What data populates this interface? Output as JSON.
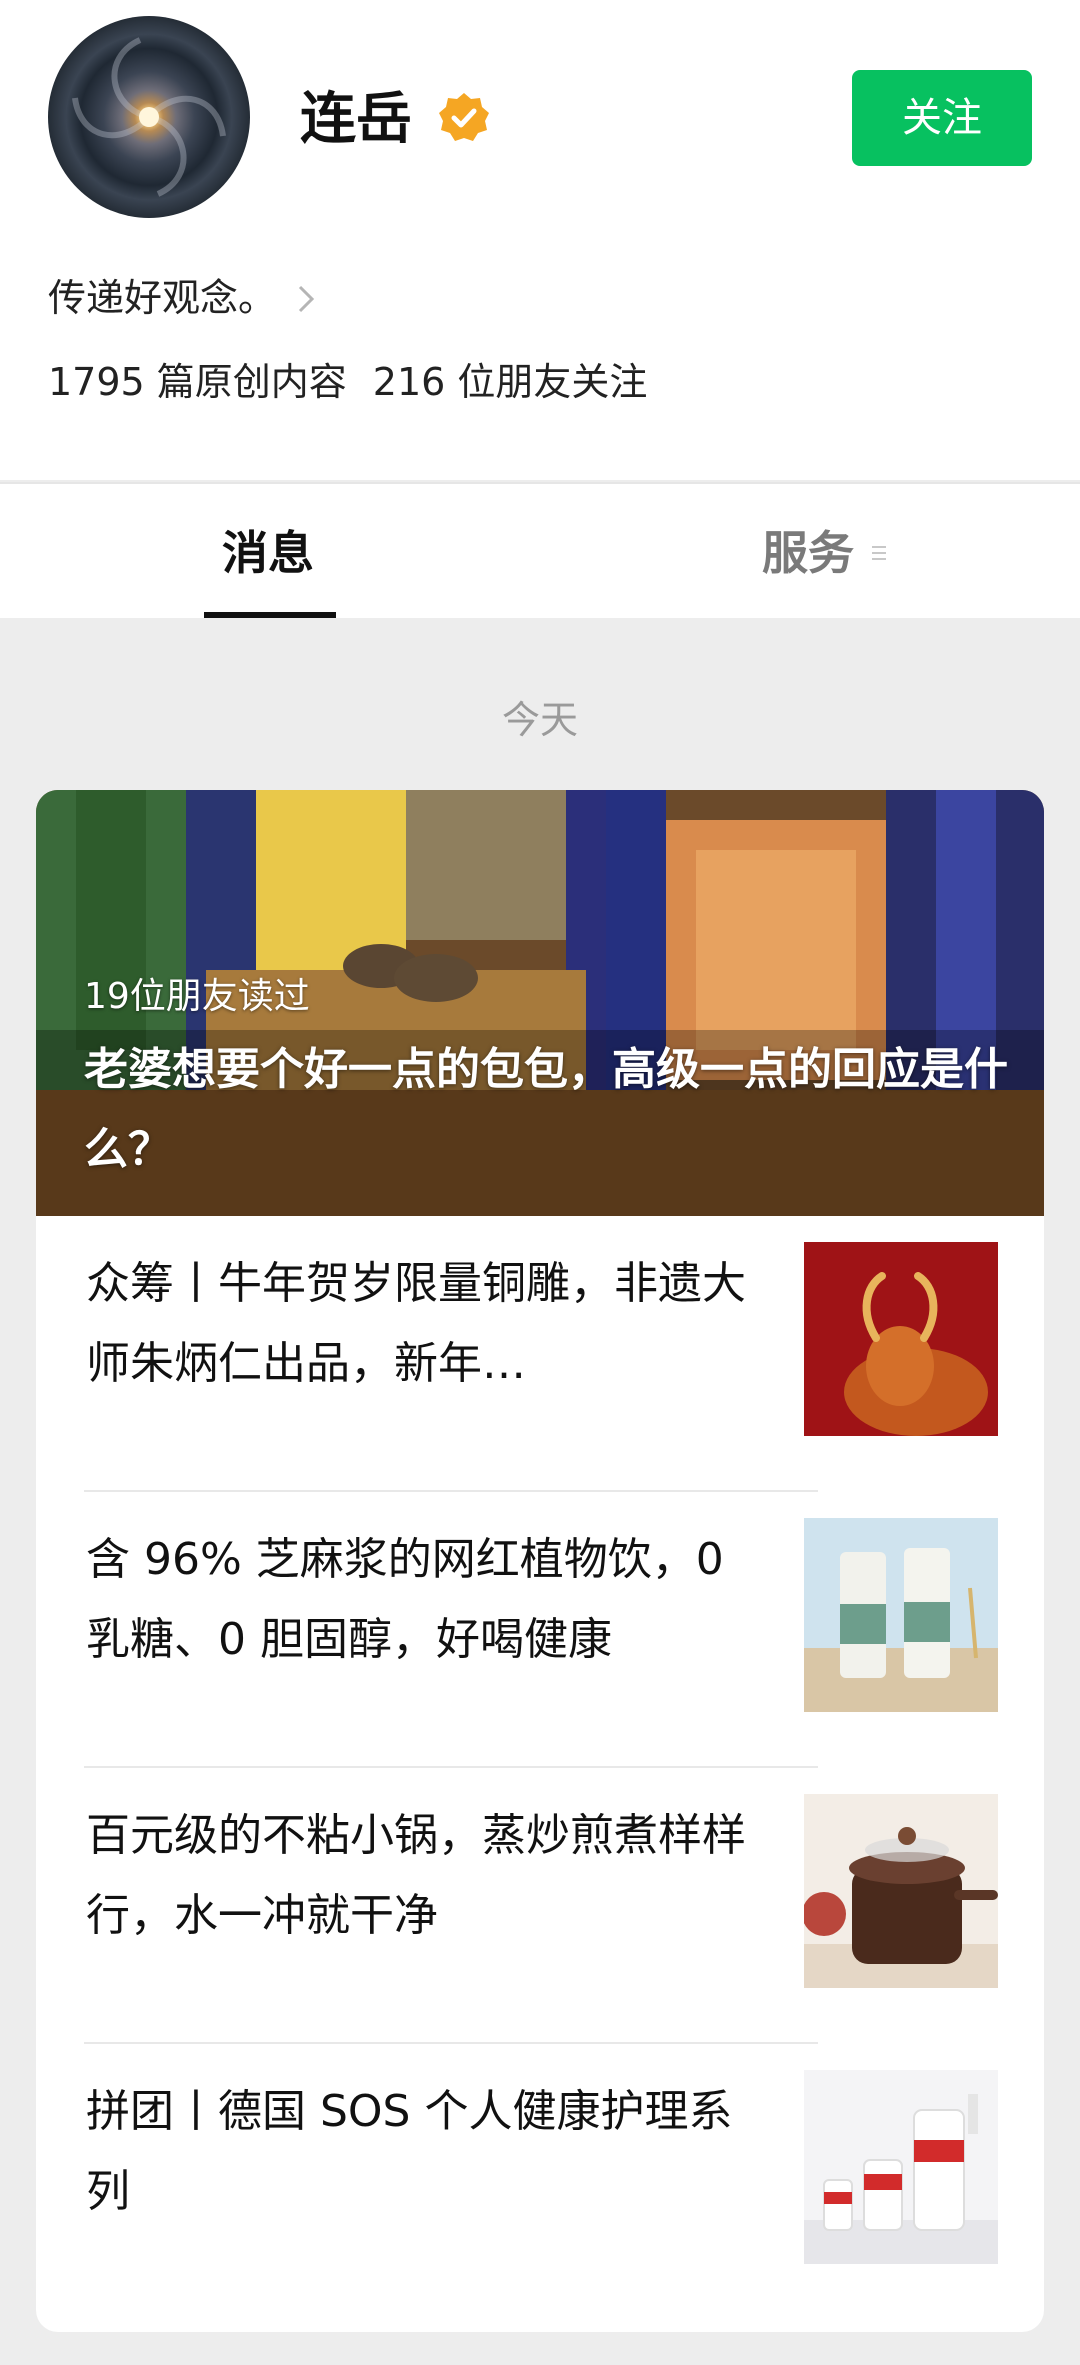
{
  "profile": {
    "name": "连岳",
    "follow_label": "关注",
    "bio": "传递好观念。",
    "original_count": "1795 篇原创内容",
    "friends_following": "216 位朋友关注"
  },
  "tabs": [
    {
      "label": "消息",
      "active": true
    },
    {
      "label": "服务",
      "active": false
    }
  ],
  "date_label": "今天",
  "featured": {
    "readers": "19位朋友读过",
    "title": "老婆想要个好一点的包包，高级一点的回应是什么？"
  },
  "articles": [
    {
      "title": "众筹丨牛年贺岁限量铜雕，非遗大师朱炳仁出品，新年…"
    },
    {
      "title": "含 96% 芝麻浆的网红植物饮，0 乳糖、0 胆固醇，好喝健康"
    },
    {
      "title": "百元级的不粘小锅，蒸炒煎煮样样行，水一冲就干净"
    },
    {
      "title": "拼团丨德国 SOS 个人健康护理系列"
    }
  ],
  "colors": {
    "accent_green": "#07c160",
    "verified_orange": "#f5a623",
    "page_background": "#ededed"
  },
  "icons": [
    "verified-badge-icon",
    "chevron-right-icon",
    "menu-lines-icon"
  ]
}
